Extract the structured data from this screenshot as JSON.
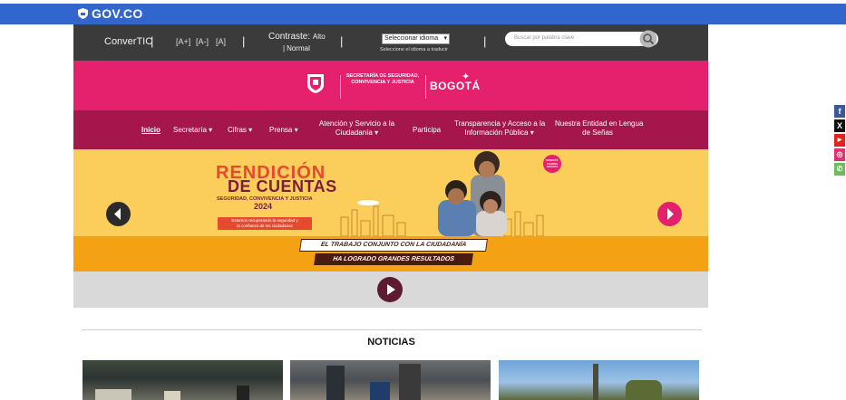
{
  "gov_bar": {
    "logo_text": "GOV.CO"
  },
  "topbar": {
    "convertic": "ConverTIC",
    "font_size_buttons": [
      "[A+]",
      "[A-]",
      "[A]"
    ],
    "contrast_label": "Contraste:",
    "contrast_high": "Alto",
    "contrast_normal": "Normal",
    "language_select_value": "Seleccionar idioma",
    "language_hint": "Seleccione el idioma a traducir",
    "search_placeholder": "Buscar por palabra clave"
  },
  "brand": {
    "secretaria_text": "SECRETARÍA DE SEGURIDAD, CONVIVENCIA Y JUSTICIA",
    "bogota_text": "BOGOTÁ"
  },
  "nav": {
    "items": [
      {
        "label": "Inicio"
      },
      {
        "label": "Secretaría",
        "has_dropdown": true
      },
      {
        "label": "Cifras",
        "has_dropdown": true
      },
      {
        "label": "Prensa",
        "has_dropdown": true
      },
      {
        "label": "Atención y Servicio a la",
        "label2": "Ciudadanía",
        "has_dropdown": true
      },
      {
        "label": "Participa"
      },
      {
        "label": "Transparencia y Acceso a la",
        "label2": "Información Pública",
        "has_dropdown": true
      },
      {
        "label": "Nuestra Entidad en Lengua",
        "label2": "de Señas"
      }
    ],
    "dropdown_caret": "▾"
  },
  "hero": {
    "title_line1": "RENDICIÓN",
    "title_line2": "DE CUENTAS",
    "subtitle": "SEGURIDAD, CONVIVENCIA Y JUSTICIA",
    "year": "2024",
    "pill_line1": "Estamos recuperando la seguridad y",
    "pill_line2": "la confianza de los ciudadanos",
    "badge_text": "BOGOTÁ CAMINA SEGURA"
  },
  "strip": {
    "line1": "EL TRABAJO CONJUNTO CON LA CIUDADANÍA",
    "line2": "HA LOGRADO GRANDES RESULTADOS"
  },
  "news": {
    "title": "NOTICIAS"
  },
  "social": [
    "facebook-icon",
    "x-icon",
    "youtube-icon",
    "instagram-icon",
    "whatsapp-icon"
  ],
  "colors": {
    "gov_blue": "#3366cc",
    "topbar": "#3b3b3b",
    "brand_pink": "#e5216d",
    "nav_maroon": "#a5174c",
    "hero_yellow": "#fbcd5a",
    "strip_orange": "#f4a213",
    "video_bg": "#d9d9d9"
  }
}
